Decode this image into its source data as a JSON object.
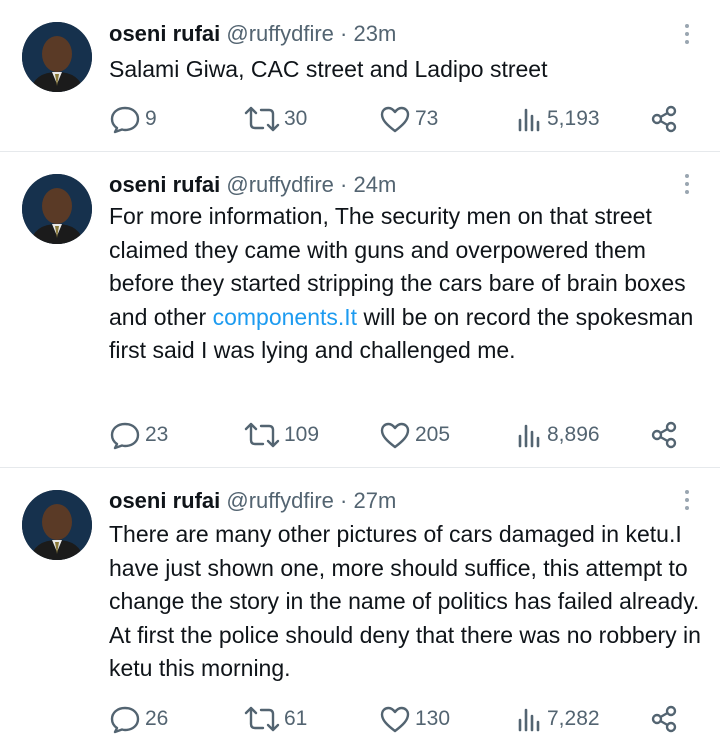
{
  "tweets": [
    {
      "author": "oseni rufai",
      "handle": "@ruffydfire",
      "separator": "·",
      "time": "23m",
      "text_parts": [
        "Salami Giwa, CAC street and Ladipo street"
      ],
      "link": "",
      "text_after": "",
      "replies": "9",
      "retweets": "30",
      "likes": "73",
      "views": "5,193"
    },
    {
      "author": "oseni rufai",
      "handle": "@ruffydfire",
      "separator": "·",
      "time": "24m",
      "text_parts": [
        "For more information, The security men on that street claimed they came with guns and overpowered them before they started stripping the cars bare of brain boxes and other "
      ],
      "link": "components.It",
      "text_after": " will be on record the spokesman first said I was lying and challenged me.",
      "replies": "23",
      "retweets": "109",
      "likes": "205",
      "views": "8,896"
    },
    {
      "author": "oseni rufai",
      "handle": "@ruffydfire",
      "separator": "·",
      "time": "27m",
      "text_parts": [
        "There are many other pictures of cars damaged in ketu.I have just shown one, more should suffice, this attempt to change the story in the name of politics has failed already. At first the police should deny that there was no robbery in ketu this morning."
      ],
      "link": "",
      "text_after": "",
      "replies": "26",
      "retweets": "61",
      "likes": "130",
      "views": "7,282"
    }
  ],
  "colors": {
    "text": "#0f1419",
    "secondary": "#536471",
    "link": "#1d9bf0",
    "divider": "#e6e9ec"
  },
  "icons": [
    "reply-icon",
    "retweet-icon",
    "like-icon",
    "views-icon",
    "share-icon",
    "more-icon"
  ]
}
